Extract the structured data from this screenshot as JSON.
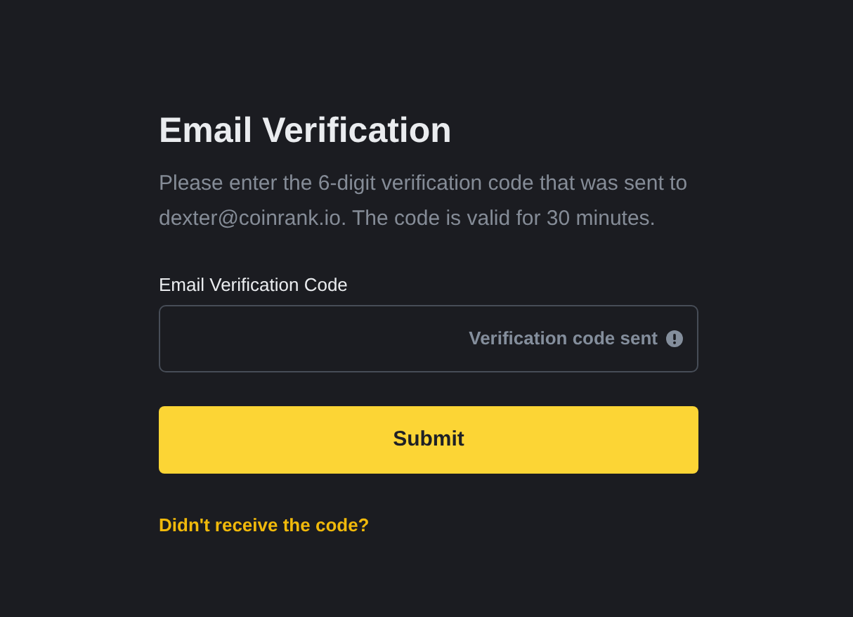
{
  "title": "Email Verification",
  "description": "Please enter the 6-digit verification code that was sent to dexter@coinrank.io. The code is valid for 30 minutes.",
  "field": {
    "label": "Email Verification Code",
    "status": "Verification code sent"
  },
  "submit": "Submit",
  "link": "Didn't receive the code?"
}
